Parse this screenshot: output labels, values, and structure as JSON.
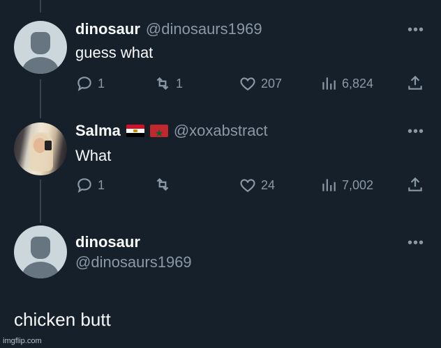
{
  "tweets": [
    {
      "name": "dinosaur",
      "handle": "@dinosaurs1969",
      "text": "guess what",
      "replies": "1",
      "retweets": "1",
      "likes": "207",
      "views": "6,824"
    },
    {
      "name": "Salma",
      "flags": [
        "egypt-flag",
        "morocco-flag"
      ],
      "handle": "@xoxabstract",
      "text": "What",
      "replies": "1",
      "retweets": "",
      "likes": "24",
      "views": "7,002"
    },
    {
      "name": "dinosaur",
      "handle": "@dinosaurs1969",
      "text": "chicken butt"
    }
  ],
  "more_label": "•••",
  "watermark": "imgflip.com",
  "colors": {
    "background": "#15202b",
    "text_primary": "#f7f9f9",
    "text_secondary": "#8b98a5",
    "thread_line": "#38444d"
  }
}
